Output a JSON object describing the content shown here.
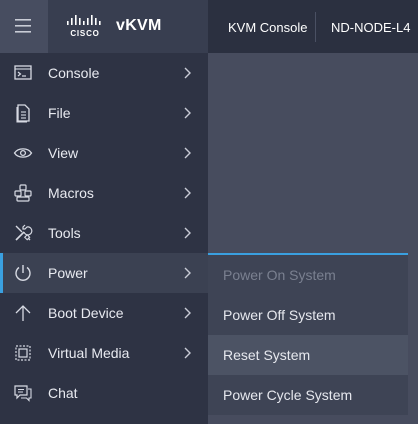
{
  "header": {
    "app_title": "vKVM",
    "logo_text": "CISCO",
    "kvm_console_label": "KVM Console",
    "node_label": "ND-NODE-L4"
  },
  "sidebar": {
    "items": [
      {
        "label": "Console",
        "icon": "console-icon"
      },
      {
        "label": "File",
        "icon": "file-icon"
      },
      {
        "label": "View",
        "icon": "eye-icon"
      },
      {
        "label": "Macros",
        "icon": "macros-icon"
      },
      {
        "label": "Tools",
        "icon": "tools-icon"
      },
      {
        "label": "Power",
        "icon": "power-icon"
      },
      {
        "label": "Boot Device",
        "icon": "boot-arrow-icon"
      },
      {
        "label": "Virtual Media",
        "icon": "virtual-media-icon"
      },
      {
        "label": "Chat",
        "icon": "chat-icon"
      }
    ]
  },
  "power_submenu": {
    "items": [
      {
        "label": "Power On System",
        "state": "disabled"
      },
      {
        "label": "Power Off System",
        "state": "normal"
      },
      {
        "label": "Reset System",
        "state": "hover"
      },
      {
        "label": "Power Cycle System",
        "state": "normal"
      }
    ]
  },
  "colors": {
    "accent": "#3aa0e0",
    "sidebar_bg": "#2e3344",
    "content_bg": "#474c5e"
  }
}
